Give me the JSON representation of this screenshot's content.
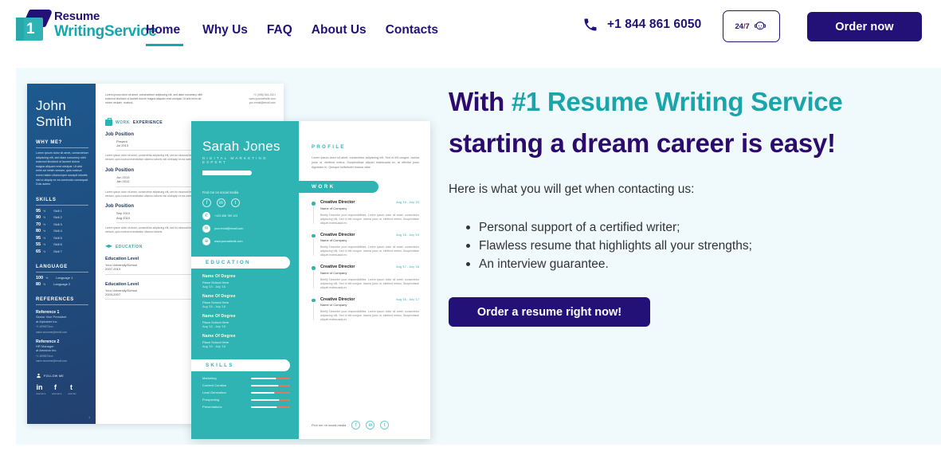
{
  "header": {
    "logo": {
      "line1": "Resume",
      "line2": "WritingService",
      "badge_number": "1"
    },
    "nav": [
      {
        "label": "Home",
        "active": true
      },
      {
        "label": "Why Us",
        "active": false
      },
      {
        "label": "FAQ",
        "active": false
      },
      {
        "label": "About Us",
        "active": false
      },
      {
        "label": "Contacts",
        "active": false
      }
    ],
    "phone": "+1 844 861 6050",
    "support_badge": {
      "hours": "24",
      "slash": "/",
      "days": "7",
      "icon": "support-agent-icon"
    },
    "order_button": "Order now"
  },
  "hero": {
    "title_part1": "With ",
    "title_highlight": "#1 Resume Writing Service",
    "title_line2": "starting a dream career is easy!",
    "subtitle": "Here is what you will get when contacting us:",
    "bullets": [
      "Personal support of a certified writer;",
      "Flawless resume that highlights all your strengths;",
      "An interview guarantee."
    ],
    "cta": "Order a resume right now!"
  },
  "resume1": {
    "name_line1": "John",
    "name_line2": "Smith",
    "why_me_heading": "WHY ME?",
    "why_me_text": "Lorem ipsum dolor sit amet, consectetuer adipiscing elit, sed diam nonummy nibh euismod tincidunt ut laoreet dolore magna aliquam erat volutpat. Ut wisi enim ad minim veniam, quis nostrud exerci tation ullamcorper suscipit lobortis nisl ut aliquip ex ea commodo consequat. Duis autem.",
    "skills_heading": "SKILLS",
    "skills": [
      {
        "pct": "95",
        "unit": "%",
        "name": "Skill 1"
      },
      {
        "pct": "90",
        "unit": "%",
        "name": "Skill 2"
      },
      {
        "pct": "70",
        "unit": "%",
        "name": "Skill 3"
      },
      {
        "pct": "80",
        "unit": "%",
        "name": "Skill 4"
      },
      {
        "pct": "95",
        "unit": "%",
        "name": "Skill 5"
      },
      {
        "pct": "55",
        "unit": "%",
        "name": "Skill 6"
      },
      {
        "pct": "65",
        "unit": "%",
        "name": "Skill 7"
      }
    ],
    "language_heading": "LANGUAGE",
    "languages": [
      {
        "pct": "100",
        "unit": "%",
        "name": "Language 1"
      },
      {
        "pct": "80",
        "unit": "%",
        "name": "Language 2"
      }
    ],
    "references_heading": "REFERENCES",
    "references": [
      {
        "title": "Reference 1",
        "role": "Senior Vice President",
        "company": "at Alphabet Inc.",
        "phone": "+1  4896573xxx",
        "email": "name.surname@email.com"
      },
      {
        "title": "Reference 2",
        "role": "HR Manager",
        "company": "at Amazon Inc.",
        "phone": "+1  4896573xxx",
        "email": "name.surname@email.com"
      }
    ],
    "follow_label": "FOLLOW ME",
    "socials": [
      {
        "glyph": "in",
        "handle": "username"
      },
      {
        "glyph": "f",
        "handle": "username"
      },
      {
        "glyph": "t",
        "handle": "usernam"
      }
    ],
    "page_number": "1",
    "intro_text": "Lorem ipsum dolor sit amet, consectetuer adipiscing elit, sed diam nonummy nibh euismod tincidunt ut laoreet dolore magna aliquam erat volutpat. Ut wisi enim ad minim veniam, nostrud.",
    "contact": {
      "phone": "+1 (456) 344-2421",
      "website": "www.yourwebsite.com",
      "email": "you.email@email.com"
    },
    "work_heading_1": "WORK",
    "work_heading_2": "EXPERIENCE",
    "jobs": [
      {
        "title": "Job Position",
        "date_from": "Present",
        "date_to": "Jul 2013",
        "body": "Lorem ipsum dolor sit amet, consectetur adipiscing elit, sed do eiusmod tempor incididunt ut labore et dolore magna aliqua. Ut enim ad minim veniam, quis nostrud exercitation ullamco laboris nisi ut aliquip ex ea commodo consequat."
      },
      {
        "title": "Job Position",
        "date_from": "Jun 2013",
        "date_to": "Jan 2011",
        "body": "Lorem ipsum dolor sit amet, consectetur adipiscing elit, sed do eiusmod tempor incididunt ut labore et dolore magna aliqua. Ut enim ad minim veniam, quis nostrud exercitation ullamco laboris nisi ut aliquip ex ea commodo."
      },
      {
        "title": "Job Position",
        "date_from": "Sep 2010",
        "date_to": "Aug 2010",
        "body": "Lorem ipsum dolor sit amet, consectetur adipiscing elit, sed do eiusmod tempor incididunt ut labore et dolore magna aliqua. Ut enim ad minim veniam, quis nostrud exercitation ullamco laboris."
      }
    ],
    "education_heading": "EDUCATION",
    "education": [
      {
        "level": "Education Level",
        "school": "Your University/School",
        "years": "2007-2013"
      },
      {
        "level": "Education Level",
        "school": "Your University/School",
        "years": "2003-2007"
      }
    ]
  },
  "resume2": {
    "name": "Sarah Jones",
    "role": "DIGITAL MARKETING EXPERT",
    "find_me": "Find me on social media",
    "socials": [
      {
        "glyph": "f"
      },
      {
        "glyph": "in"
      },
      {
        "glyph": "t"
      }
    ],
    "contacts": [
      {
        "icon": "phone-icon",
        "glyph": "✆",
        "value": "+123 456 789 123"
      },
      {
        "icon": "mail-icon",
        "glyph": "✉",
        "value": "your.email@email.com"
      },
      {
        "icon": "web-icon",
        "glyph": "⊕",
        "value": "www.yourwebsite.com"
      }
    ],
    "education_heading": "EDUCATION",
    "education": [
      {
        "degree": "Name Of Degree",
        "school": "Place School Here",
        "dates": "Aug '15 - July '18"
      },
      {
        "degree": "Name Of Degree",
        "school": "Place School Here",
        "dates": "Aug '15 - July '18"
      },
      {
        "degree": "Name Of Degree",
        "school": "Place School Here",
        "dates": "Aug '15 - July '18"
      },
      {
        "degree": "Name Of Degree",
        "school": "Place School Here",
        "dates": "Aug '15 - July '18"
      }
    ],
    "skills_heading": "SKILLS",
    "skills": [
      {
        "name": "Marketing",
        "value": 35
      },
      {
        "name": "Content Curation",
        "value": 30
      },
      {
        "name": "Lead Generation",
        "value": 40
      },
      {
        "name": "Prospecting",
        "value": 28
      },
      {
        "name": "Presentations",
        "value": 33
      }
    ],
    "profile_heading": "PROFILE",
    "profile_text": "Lorem ipsum dolor sit amet, consectetur adipiscing elit. Sed id elit congue, lacinia justo ut, eleifend metus. Suspendisse aliquet malesuada ex, at efficitur justo dignissim in. Quisque sollicitudin massa vitae.",
    "work_heading": "WORK",
    "jobs": [
      {
        "title": "Creative Director",
        "dates": "Aug '19 - July '20",
        "company": "Name of Company",
        "desc": "Briefly Describe your responsibilities. Lorem ipsum dolor sit amet, consectetur adipiscing elit. Sed id elit congue, lacinia justo ut, eleifend metus. Suspendisse aliquet malesuada ex."
      },
      {
        "title": "Creative Director",
        "dates": "Aug '18 - July '19",
        "company": "Name of Company",
        "desc": "Briefly Describe your responsibilities. Lorem ipsum dolor sit amet, consectetur adipiscing elit. Sed id elit congue, lacinia justo ut, eleifend metus. Suspendisse aliquet malesuada ex."
      },
      {
        "title": "Creative Director",
        "dates": "Aug '17 - July '18",
        "company": "Name of Company",
        "desc": "Briefly Describe your responsibilities. Lorem ipsum dolor sit amet, consectetur adipiscing elit. Sed id elit congue, lacinia justo ut, eleifend metus. Suspendisse aliquet malesuada ex."
      },
      {
        "title": "Creative Director",
        "dates": "Aug '16 - July '17",
        "company": "Name of Company",
        "desc": "Briefly Describe your responsibilities. Lorem ipsum dolor sit amet, consectetur adipiscing elit. Sed id elit congue, lacinia justo ut, eleifend metus. Suspendisse aliquet malesuada ex."
      }
    ],
    "footer_label": "Find me on social media",
    "footer_socials": [
      {
        "glyph": "f"
      },
      {
        "glyph": "in"
      },
      {
        "glyph": "t"
      }
    ]
  },
  "colors": {
    "navy": "#231178",
    "teal": "#1aa5ab",
    "hero_bg": "#f0fafd",
    "resume1_sidebar": "#22406f",
    "resume2_teal": "#2fb3b3",
    "accent_orange": "#e8775a"
  }
}
